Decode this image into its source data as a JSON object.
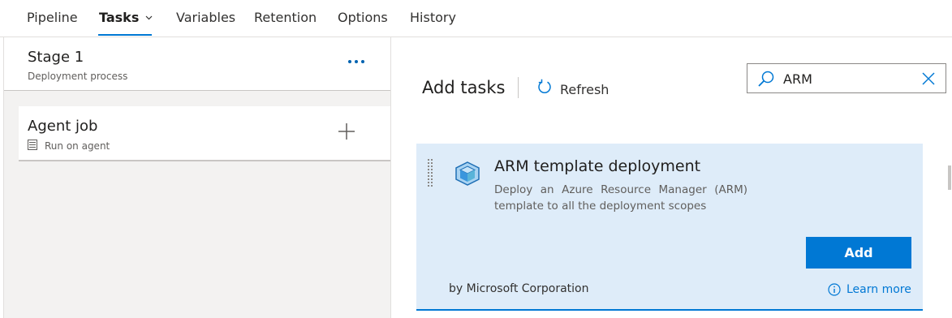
{
  "tabs": [
    {
      "label": "Pipeline",
      "active": false
    },
    {
      "label": "Tasks",
      "active": true
    },
    {
      "label": "Variables",
      "active": false
    },
    {
      "label": "Retention",
      "active": false
    },
    {
      "label": "Options",
      "active": false
    },
    {
      "label": "History",
      "active": false
    }
  ],
  "stage": {
    "title": "Stage 1",
    "subtitle": "Deployment process",
    "more_icon": "ellipsis-icon"
  },
  "agent_job": {
    "title": "Agent job",
    "subtitle": "Run on agent",
    "icon": "server-icon",
    "add_icon": "plus-icon"
  },
  "add_tasks": {
    "title": "Add tasks",
    "refresh_label": "Refresh",
    "search": {
      "value": "ARM",
      "icon": "search-icon",
      "clear_icon": "close-icon"
    },
    "results": [
      {
        "title": "ARM template deployment",
        "description": "Deploy an Azure Resource Manager (ARM) template to all the deployment scopes",
        "author": "by Microsoft Corporation",
        "add_label": "Add",
        "learn_more_label": "Learn more",
        "icon": "azure-resource-cube-icon"
      }
    ]
  },
  "colors": {
    "accent": "#0078d4",
    "selected_card": "#deecf9",
    "left_pane": "#f3f2f1"
  }
}
